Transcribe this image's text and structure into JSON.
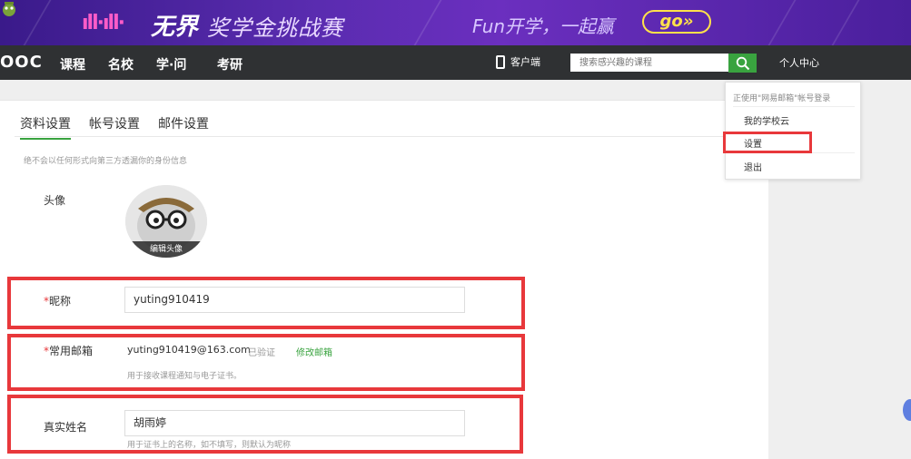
{
  "banner": {
    "bars": "ıll·ıll·",
    "brand": "无界",
    "brand_sub": "奖学金挑战赛",
    "slogan": "Fun开学，一起赢",
    "go": "go»"
  },
  "nav": {
    "logo": "OOC",
    "menu": [
      "课程",
      "名校",
      "学·问",
      "考研"
    ],
    "client_label": "客户端",
    "search_placeholder": "搜索感兴趣的课程",
    "personal_center": "个人中心"
  },
  "dropdown": {
    "header": "正使用\"网易邮箱\"帐号登录",
    "items": [
      "我的学校云",
      "设置",
      "退出"
    ]
  },
  "tabs": [
    "资料设置",
    "帐号设置",
    "邮件设置"
  ],
  "note": "绝不会以任何形式向第三方透漏你的身份信息",
  "profile": {
    "avatar_label": "头像",
    "edit_avatar": "编辑头像",
    "nickname_label": "昵称",
    "nickname_value": "yuting910419",
    "email_label": "常用邮箱",
    "email_value": "yuting910419@163.com",
    "email_verified": "已验证",
    "email_modify": "修改邮箱",
    "email_hint": "用于接收课程通知与电子证书。",
    "realname_label": "真实姓名",
    "realname_value": "胡雨婷",
    "realname_hint": "用于证书上的名称，如不填写，则默认为昵称",
    "required_mark": "*"
  },
  "colors": {
    "accent_green": "#39a33f",
    "highlight_red": "#e8383b",
    "nav_bg": "#2f3133"
  }
}
